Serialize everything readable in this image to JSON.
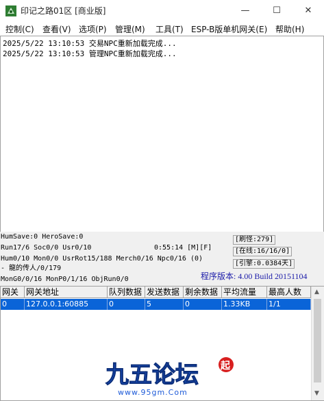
{
  "window": {
    "title": "印记之路01区 [商业版]"
  },
  "window_controls": {
    "minimize": "—",
    "maximize": "☐",
    "close": "✕"
  },
  "menu": [
    "控制(C)",
    "查看(V)",
    "选项(P)",
    "管理(M)",
    "工具(T)",
    "ESP-B版单机网关(E)",
    "帮助(H)"
  ],
  "log": [
    "2025/5/22 13:10:53 交易NPC重新加载完成...",
    "2025/5/22 13:10:53 管理NPC重新加载完成..."
  ],
  "status": {
    "hum_save": "HumSave:0 HeroSave:0",
    "run": "Run17/6 Soc0/0 Usr0/10",
    "time": "0:55:14 [M][F]",
    "hum": "Hum0/10 Mon0/0 UsrRot15/188 Merch0/16 Npc0/16 (0)",
    "heir": "- 龍的传人/0/179",
    "mong": "MonG0/0/16 MonP0/1/16 ObjRun0/0",
    "refresh_monster": "[刷怪:279]",
    "online": "[在线:16/16/0]",
    "engine": "[引擎:0.0384天]",
    "version": "程序版本: 4.00 Build 20151104"
  },
  "gateway_table": {
    "columns": [
      "网关",
      "网关地址",
      "队列数据",
      "发送数据",
      "剩余数据",
      "平均流量",
      "最高人数"
    ],
    "rows": [
      [
        "0",
        "127.0.0.1:60885",
        "0",
        "5",
        "0",
        "1.33KB",
        "1/1"
      ]
    ]
  },
  "watermark": {
    "text": "九五论坛",
    "url": "www.95gm.Com",
    "badge": "起"
  },
  "colors": {
    "selection": "#0a64d8",
    "version_text": "#1a1aa8",
    "logo_blue": "#1e5bd8",
    "logo_red": "#d82020"
  }
}
